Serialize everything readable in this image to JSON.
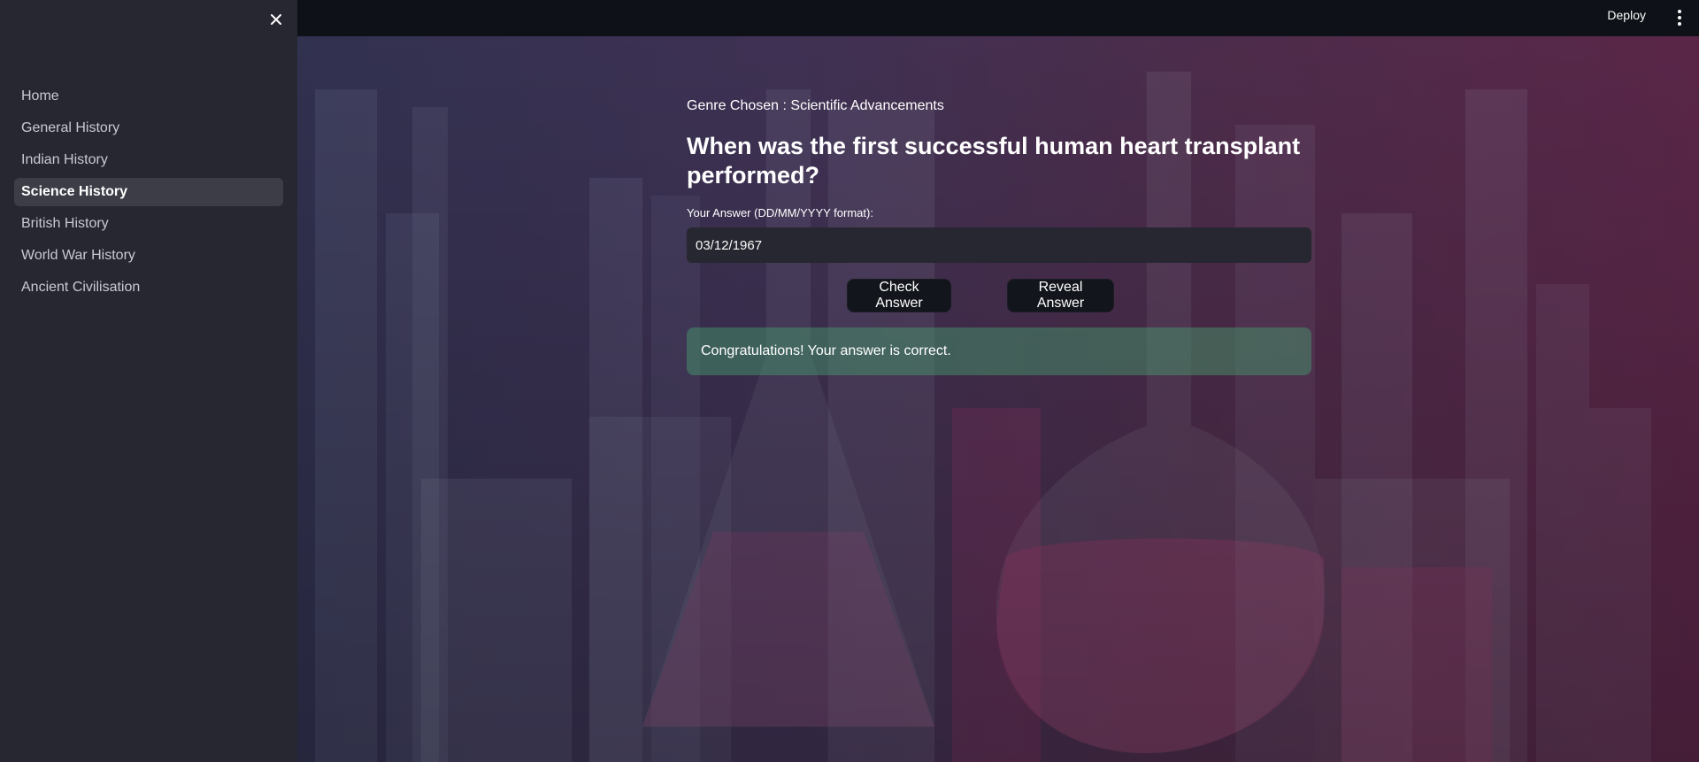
{
  "header": {
    "deploy_label": "Deploy"
  },
  "sidebar": {
    "items": [
      {
        "label": "Home"
      },
      {
        "label": "General History"
      },
      {
        "label": "Indian History"
      },
      {
        "label": "Science History"
      },
      {
        "label": "British History"
      },
      {
        "label": "World War History"
      },
      {
        "label": "Ancient Civilisation"
      }
    ],
    "active_label": "Science History"
  },
  "main": {
    "genre": "Genre Chosen : Scientific Advancements",
    "question": "When was the first successful human heart transplant performed?",
    "answer_label": "Your Answer (DD/MM/YYYY format):",
    "answer_value": "03/12/1967",
    "check_label": "Check Answer",
    "reveal_label": "Reveal Answer",
    "result_message": "Congratulations! Your answer is correct."
  },
  "colors": {
    "sidebar_bg": "#262730",
    "header_bg": "#0e1117",
    "active_item_bg": "#3c3d47",
    "success_bg": "#48a06e"
  }
}
